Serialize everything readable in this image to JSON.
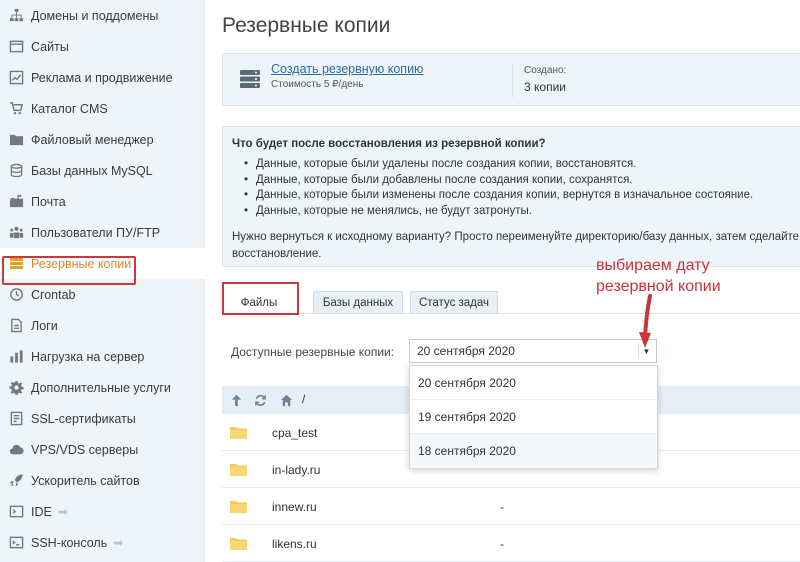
{
  "sidebar": {
    "items": [
      {
        "label": "Домены и поддомены",
        "icon": "sitemap-icon",
        "arrow": ""
      },
      {
        "label": "Сайты",
        "icon": "window-icon",
        "arrow": ""
      },
      {
        "label": "Реклама и продвижение",
        "icon": "chart-icon",
        "arrow": ""
      },
      {
        "label": "Каталог CMS",
        "icon": "cart-icon",
        "arrow": ""
      },
      {
        "label": "Файловый менеджер",
        "icon": "folder-icon",
        "arrow": ""
      },
      {
        "label": "Базы данных MySQL",
        "icon": "database-icon",
        "arrow": ""
      },
      {
        "label": "Почта",
        "icon": "mailbox-icon",
        "arrow": ""
      },
      {
        "label": "Пользователи ПУ/FTP",
        "icon": "users-icon",
        "arrow": ""
      },
      {
        "label": "Резервные копии",
        "icon": "backup-icon",
        "arrow": ""
      },
      {
        "label": "Crontab",
        "icon": "clock-icon",
        "arrow": ""
      },
      {
        "label": "Логи",
        "icon": "log-icon",
        "arrow": ""
      },
      {
        "label": "Нагрузка на сервер",
        "icon": "load-chart-icon",
        "arrow": ""
      },
      {
        "label": "Дополнительные услуги",
        "icon": "gear-icon",
        "arrow": ""
      },
      {
        "label": "SSL-сертификаты",
        "icon": "certificate-icon",
        "arrow": ""
      },
      {
        "label": "VPS/VDS серверы",
        "icon": "cloud-icon",
        "arrow": ""
      },
      {
        "label": "Ускоритель сайтов",
        "icon": "rocket-icon",
        "arrow": ""
      },
      {
        "label": "IDE",
        "icon": "ide-icon",
        "arrow": "➡"
      },
      {
        "label": "SSH-консоль",
        "icon": "terminal-icon",
        "arrow": "➡"
      }
    ],
    "active_index": 8
  },
  "page": {
    "title": "Резервные копии"
  },
  "summary": {
    "create_link": "Создать резервную копию",
    "cost": "Стоимость 5 ₽/день",
    "created_label": "Создано:",
    "created_value": "3 копии"
  },
  "info": {
    "title": "Что будет после восстановления из резервной копии?",
    "bullets": [
      "Данные, которые были удалены после создания копии, восстановятся.",
      "Данные, которые были добавлены после создания копии, сохранятся.",
      "Данные, которые были изменены после создания копии, вернутся в изначальное состояние.",
      "Данные, которые не менялись, не будут затронуты."
    ],
    "note": "Нужно вернуться к исходному варианту? Просто переименуйте директорию/базу данных, затем сделайте восстановление."
  },
  "tabs": [
    {
      "label": "Файлы",
      "active": true
    },
    {
      "label": "Базы данных",
      "active": false
    },
    {
      "label": "Статус задач",
      "active": false
    }
  ],
  "backups": {
    "label": "Доступные резервные копии:",
    "selected": "20 сентября 2020",
    "options": [
      "20 сентября 2020",
      "19 сентября 2020",
      "18 сентября 2020"
    ]
  },
  "file_browser": {
    "path": "/",
    "rows": [
      {
        "name": "cpa_test",
        "size": ""
      },
      {
        "name": "in-lady.ru",
        "size": ""
      },
      {
        "name": "innew.ru",
        "size": "-"
      },
      {
        "name": "likens.ru",
        "size": "-"
      }
    ]
  },
  "annotation": {
    "line1": "выбираем дату",
    "line2": "резервной копии"
  },
  "colors": {
    "accent_red": "#c8393f",
    "active_orange": "#d9892b",
    "link_blue": "#2d6a9f",
    "panel_bg": "#eef5f9"
  }
}
